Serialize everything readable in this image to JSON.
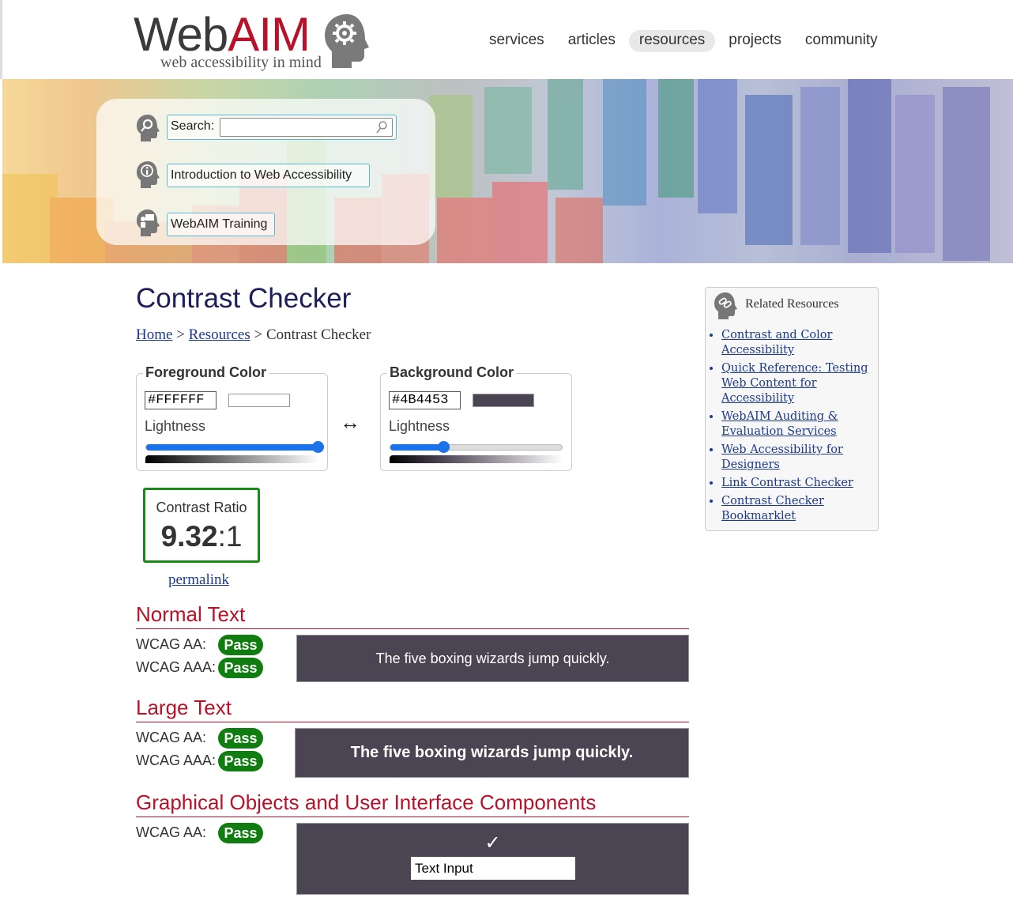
{
  "header": {
    "logo_web": "Web",
    "logo_aim": "AIM",
    "logo_tagline": "web accessibility in mind",
    "nav": [
      {
        "label": "services",
        "active": false
      },
      {
        "label": "articles",
        "active": false
      },
      {
        "label": "resources",
        "active": true
      },
      {
        "label": "projects",
        "active": false
      },
      {
        "label": "community",
        "active": false
      }
    ]
  },
  "quicklinks": {
    "search_label": "Search:",
    "search_value": "",
    "intro_label": "Introduction to Web Accessibility",
    "training_label": "WebAIM Training"
  },
  "main": {
    "title": "Contrast Checker",
    "breadcrumb": {
      "home": "Home",
      "sep1": " > ",
      "resources": "Resources",
      "sep2": " > ",
      "current": "Contrast Checker"
    },
    "foreground": {
      "legend": "Foreground Color",
      "hex": "#FFFFFF",
      "swatch_color": "#FFFFFF",
      "lightness_label": "Lightness",
      "lightness_fraction": 1.0
    },
    "swap_symbol": "↔",
    "background": {
      "legend": "Background Color",
      "hex": "#4B4453",
      "swatch_color": "#4B4453",
      "lightness_label": "Lightness",
      "lightness_fraction": 0.31
    },
    "ratio": {
      "label": "Contrast Ratio",
      "value_main": "9.32",
      "value_suffix": ":1"
    },
    "permalink": "permalink",
    "sections": {
      "normal": {
        "heading": "Normal Text",
        "aa_label": "WCAG AA:",
        "aa_result": "Pass",
        "aaa_label": "WCAG AAA:",
        "aaa_result": "Pass",
        "sample": "The five boxing wizards jump quickly."
      },
      "large": {
        "heading": "Large Text",
        "aa_label": "WCAG AA:",
        "aa_result": "Pass",
        "aaa_label": "WCAG AAA:",
        "aaa_result": "Pass",
        "sample": "The five boxing wizards jump quickly."
      },
      "graphical": {
        "heading": "Graphical Objects and User Interface Components",
        "aa_label": "WCAG AA:",
        "aa_result": "Pass",
        "check_symbol": "✓",
        "text_input_label": "Text Input"
      }
    }
  },
  "sidebar": {
    "title": "Related Resources",
    "items": [
      "Contrast and Color Accessibility",
      "Quick Reference: Testing Web Content for Accessibility",
      "WebAIM Auditing & Evaluation Services",
      "Web Accessibility for Designers",
      "Link Contrast Checker",
      "Contrast Checker Bookmarklet"
    ]
  },
  "colors": {
    "brand_red": "#b8122a",
    "title_navy": "#1e1e5a",
    "link_blue": "#1d3b8c",
    "pass_green": "#0f7d0f",
    "slider_blue": "#1a73e8",
    "sample_bg": "#4B4453",
    "sample_fg": "#FFFFFF"
  }
}
